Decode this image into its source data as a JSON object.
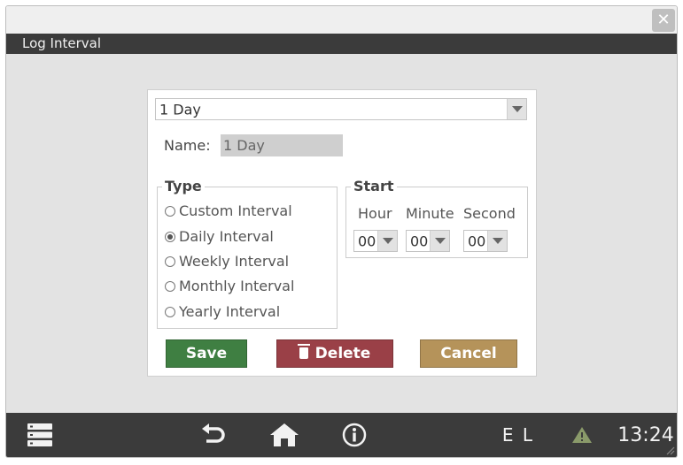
{
  "window": {
    "title": "Log Interval",
    "close_glyph": "✕"
  },
  "interval_select": {
    "value": "1 Day"
  },
  "name_field": {
    "label": "Name:",
    "value": "1 Day"
  },
  "type_group": {
    "legend": "Type",
    "options": [
      {
        "label": "Custom Interval",
        "checked": false
      },
      {
        "label": "Daily Interval",
        "checked": true
      },
      {
        "label": "Weekly Interval",
        "checked": false
      },
      {
        "label": "Monthly Interval",
        "checked": false
      },
      {
        "label": "Yearly Interval",
        "checked": false
      }
    ]
  },
  "start_group": {
    "legend": "Start",
    "hour_label": "Hour",
    "minute_label": "Minute",
    "second_label": "Second",
    "hour_value": "00",
    "minute_value": "00",
    "second_value": "00"
  },
  "buttons": {
    "save": "Save",
    "delete": "Delete",
    "cancel": "Cancel"
  },
  "taskbar": {
    "status_text": "E L",
    "clock": "13:24",
    "icons": [
      "menu-icon",
      "back-icon",
      "home-icon",
      "info-icon",
      "warning-icon"
    ]
  },
  "colors": {
    "save": "#3f7f42",
    "delete": "#9a4047",
    "cancel": "#b5935a",
    "bar": "#3b3b3b",
    "warning": "#8a9a6a"
  }
}
